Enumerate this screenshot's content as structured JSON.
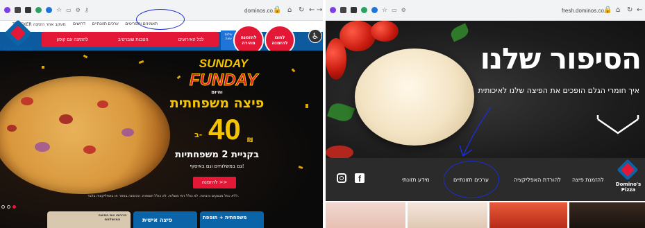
{
  "colors": {
    "brand_blue": "#0b64a8",
    "brand_red": "#e31837",
    "promo_yellow": "#f5c400",
    "annotation_ink": "#1a2ecf"
  },
  "left": {
    "url": "dominos.co.il",
    "top_links": [
      "תאמינים ותפריטים",
      "ערכים תזונתיים",
      "דרושים"
    ],
    "tracker_label": "TRACKER מעקב אחר הזמנה",
    "red_bar_items": [
      "לכל האירועים",
      "הטבות שוברטיב",
      "להזמנה עם קופון",
      "שלום שווה"
    ],
    "circle_buttons": {
      "delivery": "להזמנה מהירה",
      "takeaway": "לחצו להזמנה"
    },
    "hero": {
      "sunday": "SUNDAY",
      "funday": "FUNDAY",
      "and_now": "והיום",
      "headline": "פיצה משפחתית",
      "price": "40",
      "currency": "₪",
      "prefix": "ב-",
      "deal": "בקניית 2 משפחתיות",
      "deal_note": "גם במשלוחים וגם באיסוף!",
      "order_button": "להזמנה >>",
      "disclaimer": "ללא כפל מבצעים והנחות. לא כולל דמי משלוח. לא כולל תוספות. ההזמנה באתר או באפליקציה בלבד."
    },
    "cards": [
      "פיצה אישית",
      "משפחתית + תוספת",
      "הרכיבו את הפיצה המושלמת"
    ],
    "logo_text": "Domino's Pizza"
  },
  "right": {
    "url": "fresh.dominos.co.il",
    "title": "הסיפור שלנו",
    "subtitle": "איך חומרי הגלם הופכים את הפיצה שלנו לאיכותית",
    "nav": [
      "להזמנת פיצה",
      "להורדת האפליקציה",
      "ערכים תזונתיים",
      "מידע תזונתי"
    ],
    "logo_text": "Domino's Pizza"
  }
}
